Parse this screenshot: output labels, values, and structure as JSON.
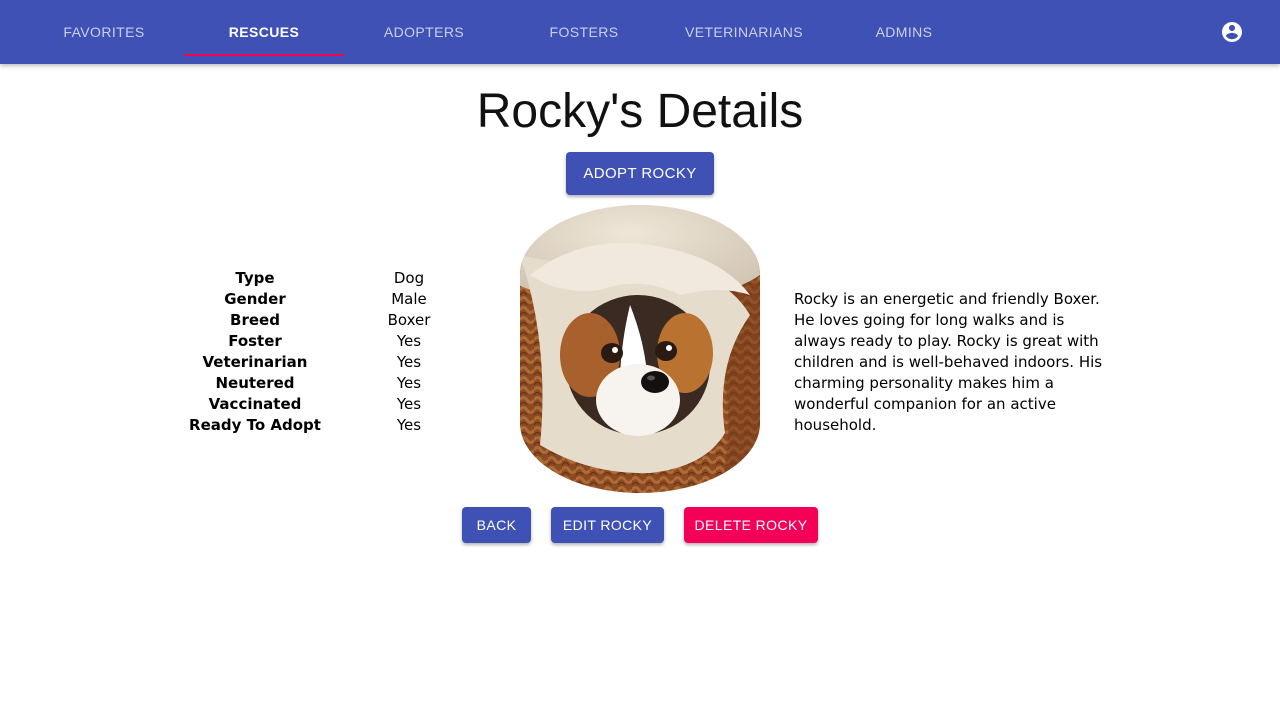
{
  "nav": {
    "tabs": [
      {
        "label": "FAVORITES"
      },
      {
        "label": "RESCUES"
      },
      {
        "label": "ADOPTERS"
      },
      {
        "label": "FOSTERS"
      },
      {
        "label": "VETERINARIANS"
      },
      {
        "label": "ADMINS"
      }
    ],
    "active_tab": "RESCUES",
    "account_icon": "account-circle-icon"
  },
  "page": {
    "title": "Rocky's Details",
    "adopt_button": "ADOPT ROCKY"
  },
  "details": [
    {
      "label": "Type",
      "value": "Dog"
    },
    {
      "label": "Gender",
      "value": "Male"
    },
    {
      "label": "Breed",
      "value": "Boxer"
    },
    {
      "label": "Foster",
      "value": "Yes"
    },
    {
      "label": "Veterinarian",
      "value": "Yes"
    },
    {
      "label": "Neutered",
      "value": "Yes"
    },
    {
      "label": "Vaccinated",
      "value": "Yes"
    },
    {
      "label": "Ready To Adopt",
      "value": "Yes"
    }
  ],
  "description": "Rocky is an energetic and friendly Boxer. He loves going for long walks and is always ready to play. Rocky is great with children and is well-behaved indoors. His charming personality makes him a wonderful companion for an active household.",
  "actions": {
    "back": "BACK",
    "edit": "EDIT ROCKY",
    "delete": "DELETE ROCKY"
  },
  "colors": {
    "primary": "#3f51b5",
    "accent": "#f50057"
  }
}
